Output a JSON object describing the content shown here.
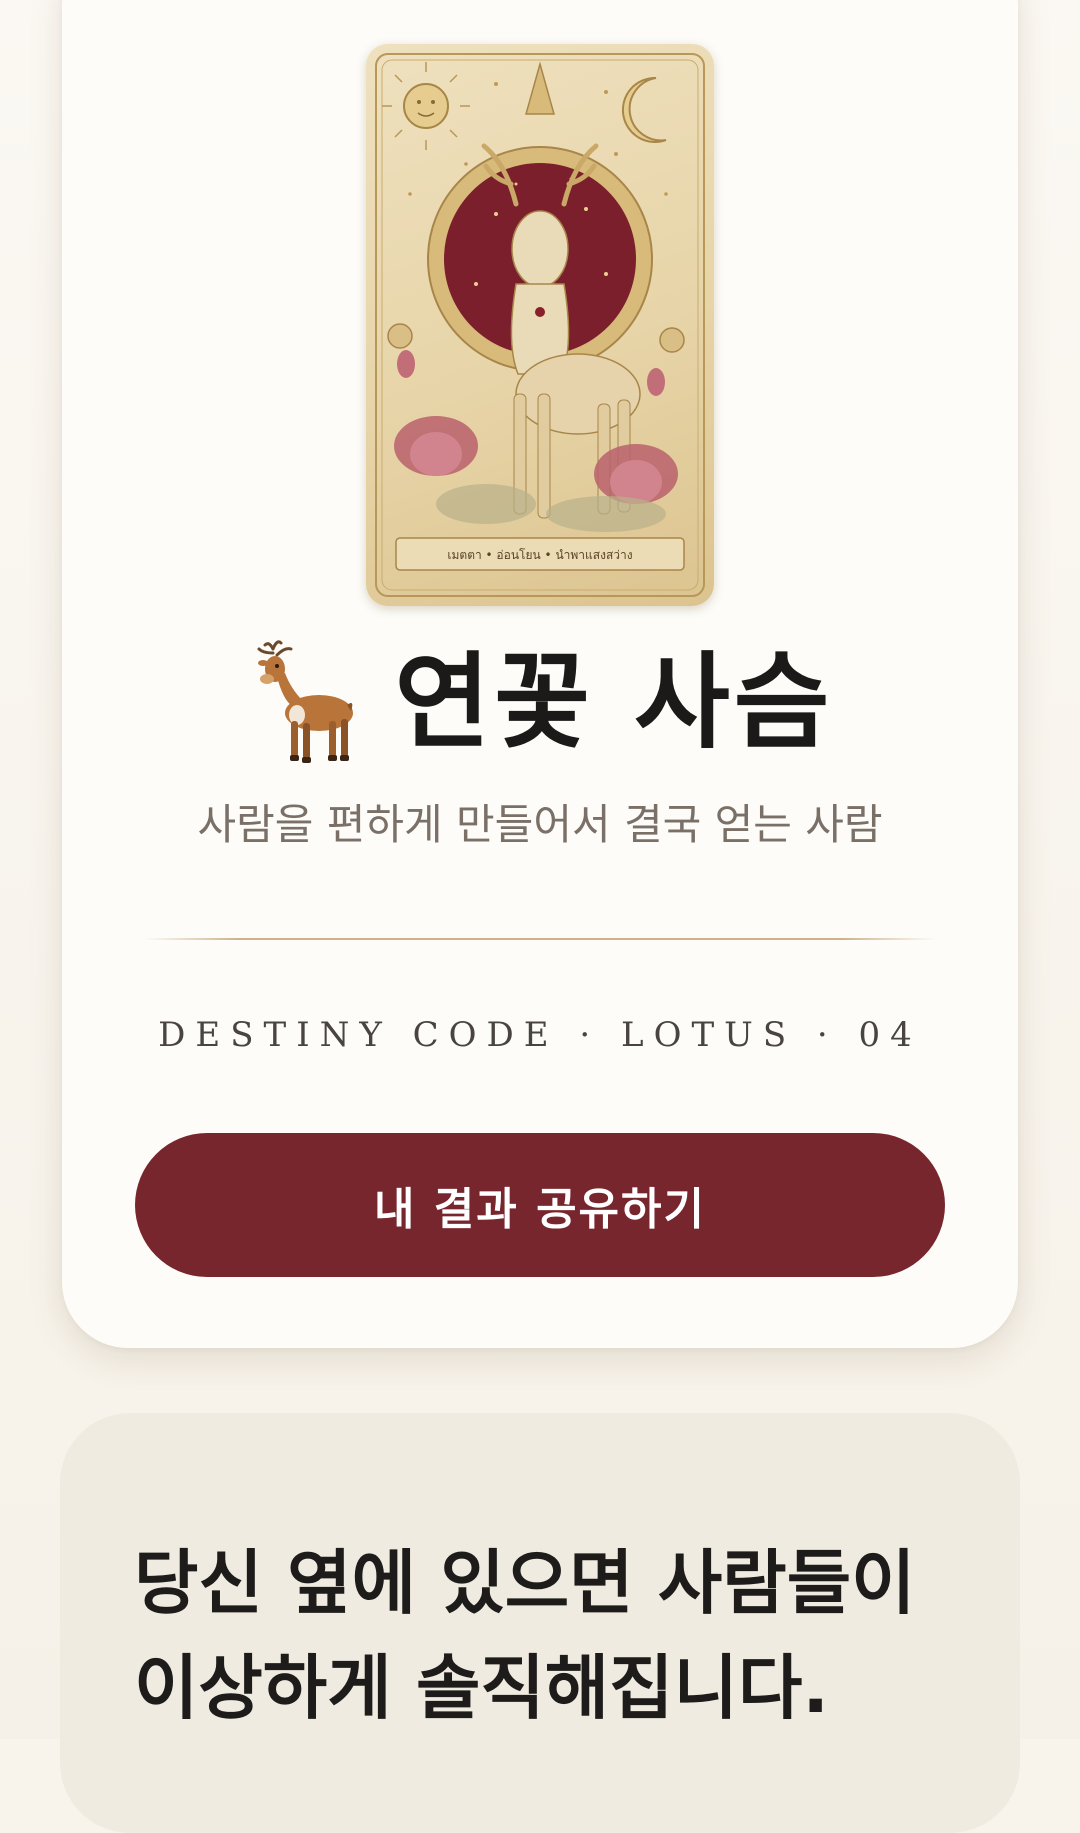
{
  "result": {
    "card_caption": "เมตตา • อ่อนโยน • นำพาแสงสว่าง",
    "title_icon": "deer-emoji",
    "type_name": "연꽃 사슴",
    "subtitle": "사람을 편하게 만들어서 결국 얻는 사람",
    "destiny_code": "DESTINY CODE · LOTUS · 04",
    "share_button_label": "내 결과 공유하기"
  },
  "description": {
    "line1": "당신 옆에 있으면 사람들이",
    "line2": "이상하게 솔직해집니다."
  },
  "colors": {
    "accent": "#78262d",
    "card_bg": "#fdfcf9",
    "page_bg": "#f8f4ec",
    "desc_bg": "#f0ebe1",
    "divider": "#cdb28a"
  }
}
